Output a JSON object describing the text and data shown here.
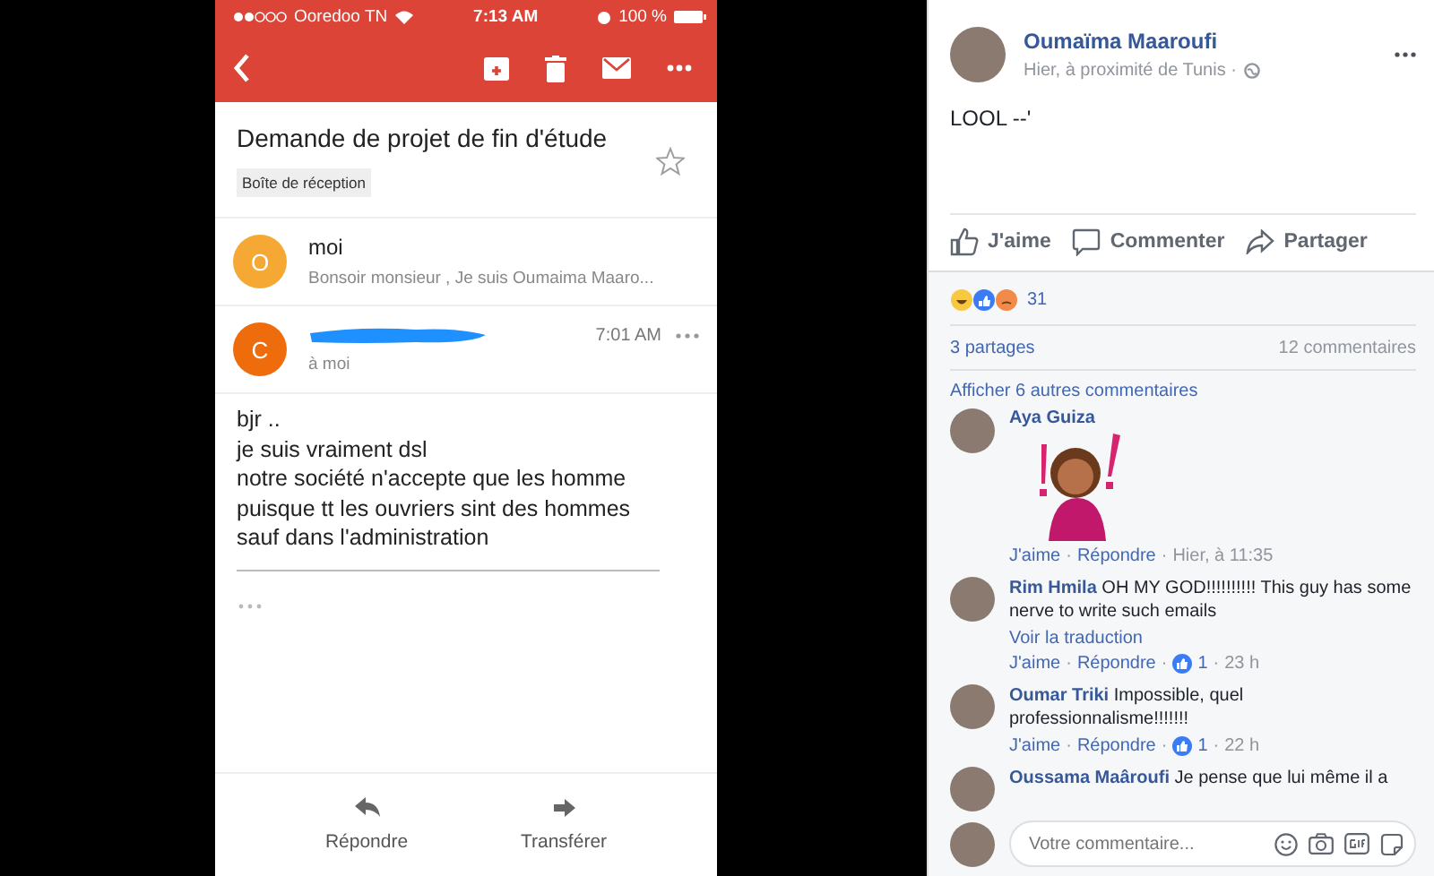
{
  "email_screenshot": {
    "status_bar": {
      "carrier": "Ooredoo TN",
      "time": "7:13 AM",
      "battery": "100 %"
    },
    "subject": "Demande de projet de fin d'étude",
    "label": "Boîte de réception",
    "starred": false,
    "messages": [
      {
        "kind": "collapsed",
        "initial": "O",
        "color": "#f5a833",
        "sender": "moi",
        "preview": "Bonsoir monsieur , Je suis Oumaima Maaro..."
      },
      {
        "kind": "expanded",
        "initial": "C",
        "color": "#ef6c0c",
        "sender_redacted": true,
        "time": "7:01 AM",
        "recipient": "à moi",
        "body": [
          "bjr ..",
          "je suis vraiment dsl",
          "notre société n'accepte que les homme",
          "puisque tt les ouvriers sint des hommes",
          "sauf dans l'administration"
        ]
      }
    ],
    "actions": [
      {
        "kind": "reply",
        "label": "Répondre"
      },
      {
        "kind": "forward",
        "label": "Transférer"
      }
    ]
  },
  "post": {
    "author": "Oumaïma Maaroufi",
    "meta": "Hier, à proximité de Tunis ·",
    "text": "LOOL --'",
    "actions": [
      {
        "kind": "like",
        "label": "J'aime"
      },
      {
        "kind": "comment",
        "label": "Commenter"
      },
      {
        "kind": "share",
        "label": "Partager"
      }
    ],
    "reactions_count": "31",
    "shares": "3 partages",
    "comments_count": "12 commentaires",
    "more_comments": "Afficher 6 autres commentaires",
    "separator": "·",
    "comments": [
      {
        "kind": "sticker",
        "author": "Aya Guiza",
        "actions": [
          "J'aime",
          "Répondre"
        ],
        "time": "Hier, à 11:35"
      },
      {
        "kind": "text",
        "author": "Rim Hmila",
        "text": "OH MY GOD!!!!!!!!!! This guy has some nerve to write such emails",
        "translate": "Voir la traduction",
        "actions": [
          "J'aime",
          "Répondre"
        ],
        "likes": "1",
        "time": "23 h"
      },
      {
        "kind": "text",
        "author": "Oumar Triki",
        "text": "Impossible, quel professionnalisme!!!!!!!",
        "actions": [
          "J'aime",
          "Répondre"
        ],
        "likes": "1",
        "time": "22 h"
      },
      {
        "kind": "text",
        "author": "Oussama Maâroufi",
        "text": "Je pense que lui même il a"
      }
    ],
    "composer": {
      "placeholder": "Votre commentaire..."
    }
  }
}
